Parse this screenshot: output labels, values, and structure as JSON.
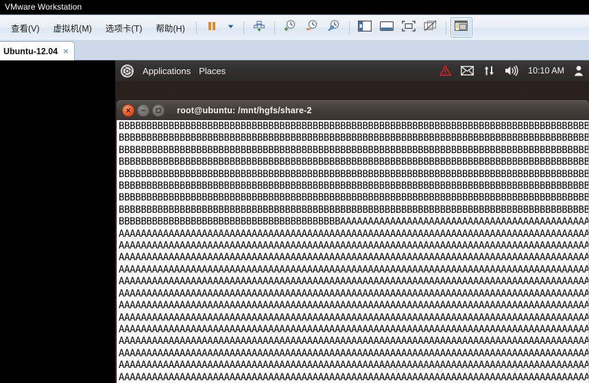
{
  "window": {
    "title": "VMware Workstation"
  },
  "menubar": {
    "items": [
      {
        "label": "查看(V)",
        "name": "menu-view"
      },
      {
        "label": "虚拟机(M)",
        "name": "menu-vm"
      },
      {
        "label": "选项卡(T)",
        "name": "menu-tabs"
      },
      {
        "label": "帮助(H)",
        "name": "menu-help"
      }
    ]
  },
  "toolbar": {
    "buttons": [
      {
        "name": "suspend-button",
        "icon": "pause-icon",
        "selected": false
      },
      {
        "name": "power-dropdown-button",
        "icon": "chevron-down-icon",
        "selected": false
      },
      {
        "name": "send-ctrl-alt-del-button",
        "icon": "keyboard-send-icon",
        "selected": false
      },
      {
        "name": "take-snapshot-button",
        "icon": "clock-plus-icon",
        "selected": false
      },
      {
        "name": "revert-snapshot-button",
        "icon": "clock-back-icon",
        "selected": false
      },
      {
        "name": "manage-snapshots-button",
        "icon": "clock-wrench-icon",
        "selected": false
      },
      {
        "name": "show-library-button",
        "icon": "sidebar-icon",
        "selected": false
      },
      {
        "name": "show-thumbnail-bar-button",
        "icon": "thumbnail-bar-icon",
        "selected": false
      },
      {
        "name": "enter-fullscreen-button",
        "icon": "fullscreen-icon",
        "selected": false
      },
      {
        "name": "unity-mode-button",
        "icon": "unity-icon",
        "selected": false
      },
      {
        "name": "console-view-button",
        "icon": "console-view-icon",
        "selected": true
      }
    ]
  },
  "tabstrip": {
    "tabs": [
      {
        "label": "Ubuntu-12.04",
        "close": "×",
        "active": true
      }
    ]
  },
  "guest": {
    "panel": {
      "logo": "ubuntu-logo-icon",
      "menus": [
        {
          "label": "Applications",
          "name": "gnome-menu-applications"
        },
        {
          "label": "Places",
          "name": "gnome-menu-places"
        }
      ],
      "tray": {
        "warning": "warning-triangle-icon",
        "mail": "envelope-icon",
        "network": "network-updown-icon",
        "volume": "volume-icon",
        "clock": "10:10 AM",
        "user": "user-icon"
      }
    },
    "terminal": {
      "title": "root@ubuntu: /mnt/hgfs/share-2",
      "buttons": {
        "close": "window-close-button",
        "minimize": "window-minimize-button",
        "maximize": "window-maximize-button"
      },
      "lines": [
        "BBBBBBBBBBBBBBBBBBBBBBBBBBBBBBBBBBBBBBBBBBBBBBBBBBBBBBBBBBBBBBBBBBBBBBBBBBBBBBBBBBBBBBBBBB",
        "BBBBBBBBBBBBBBBBBBBBBBBBBBBBBBBBBBBBBBBBBBBBBBBBBBBBBBBBBBBBBBBBBBBBBBBBBBBBBBBBBBBBBBBBBB",
        "BBBBBBBBBBBBBBBBBBBBBBBBBBBBBBBBBBBBBBBBBBBBBBBBBBBBBBBBBBBBBBBBBBBBBBBBBBBBBBBBBBBBBBBBBB",
        "BBBBBBBBBBBBBBBBBBBBBBBBBBBBBBBBBBBBBBBBBBBBBBBBBBBBBBBBBBBBBBBBBBBBBBBBBBBBBBBBBBBBBBBBBB",
        "BBBBBBBBBBBBBBBBBBBBBBBBBBBBBBBBBBBBBBBBBBBBBBBBBBBBBBBBBBBBBBBBBBBBBBBBBBBBBBBBBBBBBBBBBB",
        "BBBBBBBBBBBBBBBBBBBBBBBBBBBBBBBBBBBBBBBBBBBBBBBBBBBBBBBBBBBBBBBBBBBBBBBBBBBBBBBBBBBBBBBBBB",
        "BBBBBBBBBBBBBBBBBBBBBBBBBBBBBBBBBBBBBBBBBBBBBBBBBBBBBBBBBBBBBBBBBBBBBBBBBBBBBBBBBBBBBBBBBB",
        "BBBBBBBBBBBBBBBBBBBBBBBBBBBBBBBBBBBBBBBBBBBBBBBBBBBBBBBBBBBBBBBBBBBBBBBBBBBBBBBBBBBBBBBBBB",
        "BBBBBBBBBBBBBBBBBBBBBBBBBBBBBBBBBBBBBBBBAAAAAAAAAAAAAAAAAAAAAAAAAAAAAAAAAAAAAAAAAAAAAAAAAAAA",
        "AAAAAAAAAAAAAAAAAAAAAAAAAAAAAAAAAAAAAAAAAAAAAAAAAAAAAAAAAAAAAAAAAAAAAAAAAAAAAAAAAAAAAAAAAAAA",
        "AAAAAAAAAAAAAAAAAAAAAAAAAAAAAAAAAAAAAAAAAAAAAAAAAAAAAAAAAAAAAAAAAAAAAAAAAAAAAAAAAAAAAAAAAAAA",
        "AAAAAAAAAAAAAAAAAAAAAAAAAAAAAAAAAAAAAAAAAAAAAAAAAAAAAAAAAAAAAAAAAAAAAAAAAAAAAAAAAAAAAAAAAAAA",
        "AAAAAAAAAAAAAAAAAAAAAAAAAAAAAAAAAAAAAAAAAAAAAAAAAAAAAAAAAAAAAAAAAAAAAAAAAAAAAAAAAAAAAAAAAAAA",
        "AAAAAAAAAAAAAAAAAAAAAAAAAAAAAAAAAAAAAAAAAAAAAAAAAAAAAAAAAAAAAAAAAAAAAAAAAAAAAAAAAAAAAAAAAAAA",
        "AAAAAAAAAAAAAAAAAAAAAAAAAAAAAAAAAAAAAAAAAAAAAAAAAAAAAAAAAAAAAAAAAAAAAAAAAAAAAAAAAAAAAAAAAAAA",
        "AAAAAAAAAAAAAAAAAAAAAAAAAAAAAAAAAAAAAAAAAAAAAAAAAAAAAAAAAAAAAAAAAAAAAAAAAAAAAAAAAAAAAAAAAAAA",
        "AAAAAAAAAAAAAAAAAAAAAAAAAAAAAAAAAAAAAAAAAAAAAAAAAAAAAAAAAAAAAAAAAAAAAAAAAAAAAAAAAAAAAAAAAAAA",
        "AAAAAAAAAAAAAAAAAAAAAAAAAAAAAAAAAAAAAAAAAAAAAAAAAAAAAAAAAAAAAAAAAAAAAAAAAAAAAAAAAAAAAAAAAAAA",
        "AAAAAAAAAAAAAAAAAAAAAAAAAAAAAAAAAAAAAAAAAAAAAAAAAAAAAAAAAAAAAAAAAAAAAAAAAAAAAAAAAAAAAAAAAAAA",
        "AAAAAAAAAAAAAAAAAAAAAAAAAAAAAAAAAAAAAAAAAAAAAAAAAAAAAAAAAAAAAAAAAAAAAAAAAAAAAAAAAAAAAAAAAAAA",
        "AAAAAAAAAAAAAAAAAAAAAAAAAAAAAAAAAAAAAAAAAAAAAAAAAAAAAAAAAAAAAAAAAAAAAAAAAAAAAAAAAAAAAAAAAAAA",
        "AAAAAAAAAAAAAAAAAAAAAAAAAAAAAAAAAAAAAAAAAAAAAAAAAAAAAAAAAAAAAAAAAAAAAAAAAAAAAAAAAAAAAAAAAAAA"
      ],
      "watermark": "https://blog.csdn.net/BayCoral_iaodu"
    }
  },
  "colors": {
    "accent_orange": "#e08a2e",
    "panel_dark": "#2f2e2c",
    "tab_strip": "#cdd8e8",
    "selected_border": "#9bb7d4",
    "terminal_bg": "#ffffff",
    "terminal_fg": "#000000",
    "close_button": "#df4c1b"
  }
}
